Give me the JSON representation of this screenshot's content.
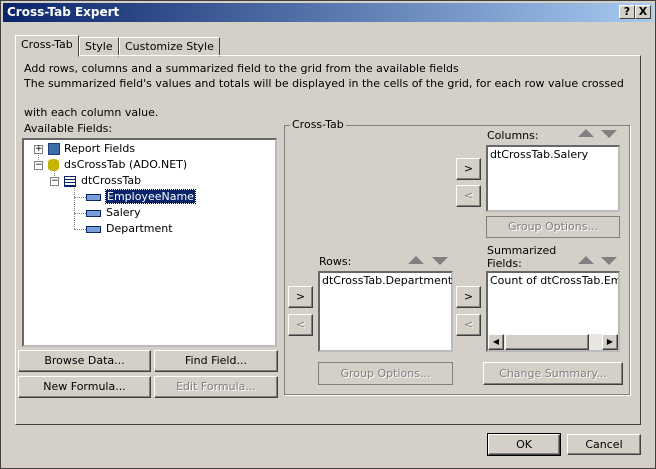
{
  "window": {
    "title": "Cross-Tab Expert",
    "help_btn": "?",
    "close_btn": "X"
  },
  "tabs": [
    {
      "label": "Cross-Tab"
    },
    {
      "label": "Style"
    },
    {
      "label": "Customize Style"
    }
  ],
  "instructions": {
    "line1": "Add rows, columns and a summarized field to the grid from the available fields",
    "line2": "The summarized field's values and totals will be displayed in the cells of the grid, for each row value crossed",
    "line3": "with each column value."
  },
  "available_fields": {
    "label": "Available Fields:",
    "tree": {
      "report_fields": "Report Fields",
      "dataset": "dsCrossTab (ADO.NET)",
      "table": "dtCrossTab",
      "fields": [
        "EmployeeName",
        "Salery",
        "Department"
      ],
      "selected": "EmployeeName"
    }
  },
  "buttons": {
    "browse_data": "Browse Data...",
    "find_field": "Find Field...",
    "new_formula": "New Formula...",
    "edit_formula": "Edit Formula...",
    "ok": "OK",
    "cancel": "Cancel"
  },
  "crosstab_group": {
    "label": "Cross-Tab",
    "columns": {
      "label": "Columns:",
      "items": [
        "dtCrossTab.Salery"
      ],
      "group_options": "Group Options..."
    },
    "rows": {
      "label": "Rows:",
      "items": [
        "dtCrossTab.Department"
      ],
      "group_options": "Group Options..."
    },
    "summarized": {
      "label_line1": "Summarized",
      "label_line2": "Fields:",
      "items": [
        "Count of dtCrossTab.Emplo"
      ],
      "change_summary": "Change Summary..."
    },
    "move_right": ">",
    "move_left": "<"
  }
}
